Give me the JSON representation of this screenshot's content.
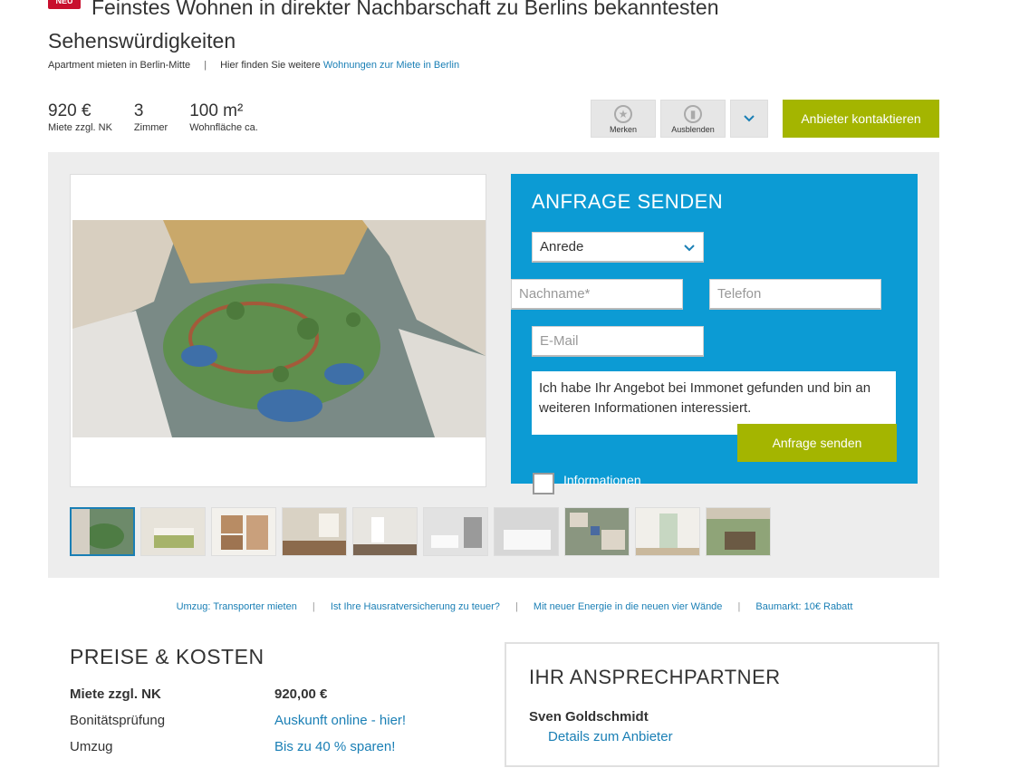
{
  "header": {
    "badge": "NEU",
    "title_line1": "Feinstes Wohnen in direkter Nachbarschaft zu Berlins bekanntesten",
    "title_line2": "Sehenswürdigkeiten",
    "subtitle": "Apartment mieten in Berlin-Mitte",
    "separator": "|",
    "hint_prefix": "Hier finden Sie weitere",
    "hint_link": "Wohnungen zur Miete in Berlin"
  },
  "facts": [
    {
      "value": "920 €",
      "label": "Miete zzgl. NK"
    },
    {
      "value": "3",
      "label": "Zimmer"
    },
    {
      "value": "100 m²",
      "label": "Wohnfläche ca."
    }
  ],
  "actions": {
    "bookmark_label": "Merken",
    "hide_label": "Ausblenden",
    "contact_label": "Anbieter kontaktieren"
  },
  "gallery": {
    "thumbnail_count": 10,
    "active_index": 0
  },
  "inquiry": {
    "title": "ANFRAGE SENDEN",
    "salutation_value": "Anrede",
    "name_placeholder": "Nachname*",
    "phone_placeholder": "Telefon",
    "email_placeholder": "E-Mail",
    "message": "Ich habe Ihr Angebot bei Immonet gefunden und bin an weiteren Informationen interessiert.",
    "send_label": "Anfrage senden",
    "checkbox_label": "Informationen"
  },
  "promo_links": [
    "Umzug: Transporter mieten",
    "Ist Ihre Hausratversicherung zu teuer?",
    "Mit neuer Energie in die neuen vier Wände",
    "Baumarkt: 10€ Rabatt"
  ],
  "prices": {
    "title": "PREISE & KOSTEN",
    "rows": [
      {
        "key": "Miete zzgl. NK",
        "value": "920,00 €"
      },
      {
        "key": "Bonitätsprüfung",
        "value": "Auskunft online - hier!"
      },
      {
        "key": "Umzug",
        "value": "Bis zu 40 % sparen!"
      }
    ]
  },
  "contact": {
    "title": "IHR ANSPRECHPARTNER",
    "name": "Sven Goldschmidt",
    "details_link": "Details zum Anbieter"
  },
  "colors": {
    "accent_blue": "#0c9bd4",
    "button_green": "#a4b500",
    "link_blue": "#1a7fb5",
    "badge_red": "#c8102e",
    "panel_gray": "#ededed"
  }
}
